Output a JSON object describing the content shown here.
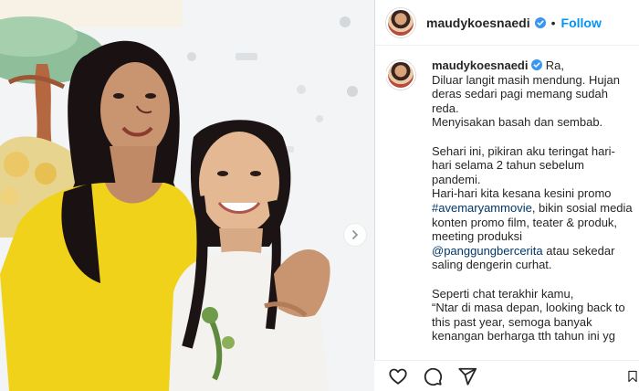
{
  "post": {
    "username": "maudykoesnaedi",
    "follow_label": "Follow",
    "separator": "•",
    "accent_color": "#0095f6",
    "link_color": "#00376b"
  },
  "caption": {
    "username": "maudykoesnaedi",
    "lines": {
      "l1": "Ra,",
      "l2": "Diluar langit masih mendung. Hujan",
      "l3": "deras sedari pagi memang sudah",
      "l4": "reda.",
      "l5": "Menyisakan basah dan sembab.",
      "l6": "Sehari ini, pikiran aku teringat hari-",
      "l7": "hari selama 2 tahun sebelum",
      "l8": "pandemi.",
      "l9": "Hari-hari kita kesana kesini promo",
      "l10_link": "#avemaryammovie",
      "l10_text": ", bikin sosial media",
      "l11": "konten promo film, teater & produk,",
      "l12": "meeting produksi",
      "l13_link": "@panggungbercerita",
      "l13_text": " atau sekedar",
      "l14": "saling dengerin curhat.",
      "l15": "Seperti chat terakhir kamu,",
      "l16": "“Ntar di masa depan, looking back to",
      "l17": "this past year, semoga banyak",
      "l18": "kenangan berharga tth tahun ini yg"
    }
  },
  "icons": {
    "like": "heart-icon",
    "comment": "comment-icon",
    "share": "share-icon",
    "save": "bookmark-icon",
    "verified": "verified-badge-icon",
    "next": "chevron-right-icon"
  }
}
